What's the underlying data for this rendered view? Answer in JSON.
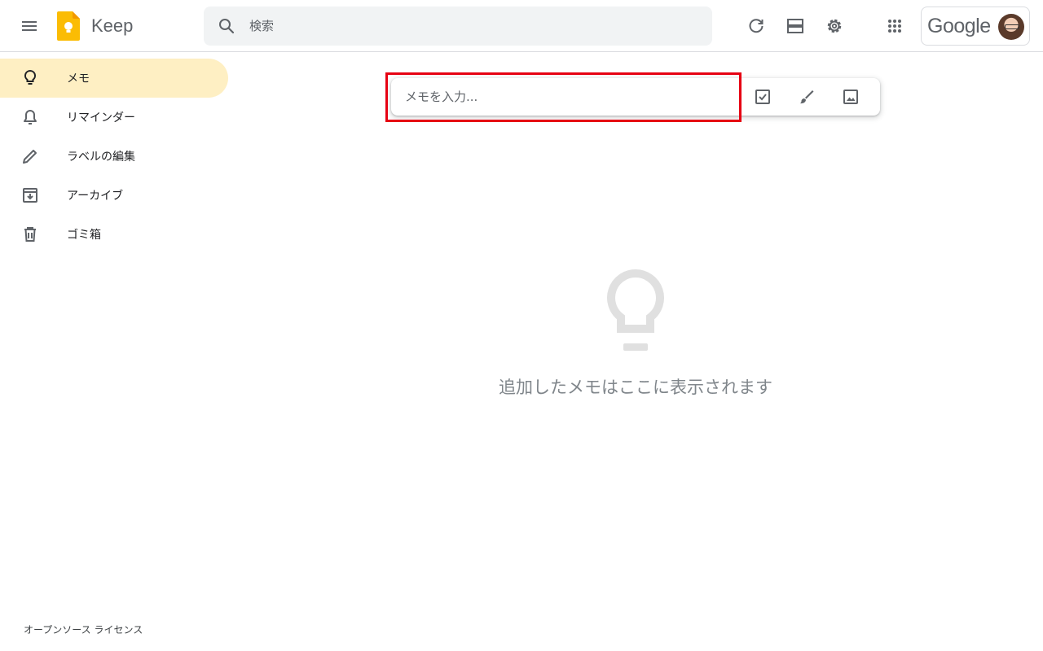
{
  "header": {
    "app_title": "Keep",
    "search_placeholder": "検索",
    "brand": "Google",
    "icons": [
      "menu-icon",
      "keep-logo",
      "search-icon",
      "refresh-icon",
      "list-view-icon",
      "settings-icon",
      "apps-icon"
    ]
  },
  "sidebar": {
    "items": [
      {
        "label": "メモ",
        "icon": "lightbulb-icon",
        "active": true
      },
      {
        "label": "リマインダー",
        "icon": "bell-icon",
        "active": false
      },
      {
        "label": "ラベルの編集",
        "icon": "pencil-icon",
        "active": false
      },
      {
        "label": "アーカイブ",
        "icon": "archive-icon",
        "active": false
      },
      {
        "label": "ゴミ箱",
        "icon": "trash-icon",
        "active": false
      }
    ],
    "footer_link": "オープンソース ライセンス"
  },
  "composer": {
    "placeholder": "メモを入力...",
    "actions": [
      "checkbox-icon",
      "brush-icon",
      "image-icon"
    ]
  },
  "empty_state": {
    "message": "追加したメモはここに表示されます"
  },
  "colors": {
    "accent_active": "#feefc3",
    "highlight": "#e60012",
    "logo_yellow": "#fbbc04",
    "icon_grey": "#5f6368"
  }
}
